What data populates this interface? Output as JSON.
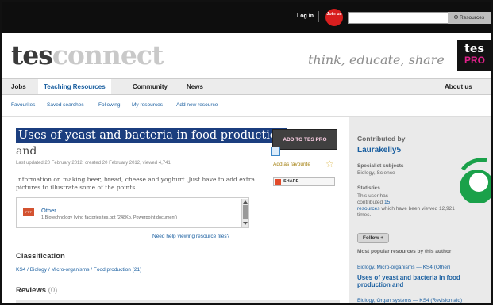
{
  "topbar": {
    "login": "Log in",
    "join": "Join us",
    "search_placeholder": "",
    "search_button": "Resources"
  },
  "brand": {
    "logo_tes": "tes",
    "logo_connect": "connect",
    "tagline": "think, educate, share",
    "badge_top": "tes",
    "badge_pro": "PRO"
  },
  "nav": {
    "items": [
      "Jobs",
      "Teaching Resources",
      "Community",
      "News"
    ],
    "right": "About us"
  },
  "subnav": {
    "links": [
      "Favourites",
      "Saved searches",
      "Following",
      "My resources",
      "Add new resource"
    ]
  },
  "resource": {
    "title_line1": "Uses of yeast and bacteria in food production",
    "title_line2": "and",
    "updated": "Last updated 20 February 2012, created 20 February 2012, viewed 4,741",
    "description": "Information on making beer, bread, cheese and yoghurt. Just have to add extra pictures to illustrate some of the points",
    "add_to_pro": "ADD TO TES PRO",
    "add_favourite": "Add as favourite",
    "share": "SHARE",
    "file": {
      "type_badge": "PPT",
      "category": "Other",
      "filename": "1.Biotechnology living factories tes.ppt (248Kb, Powerpoint document)"
    },
    "help_link": "Need help viewing resource files?",
    "classification_heading": "Classification",
    "classification_path": "KS4 / Biology / Micro-organisms / Food production (21)",
    "reviews_heading": "Reviews",
    "reviews_count": "(0)"
  },
  "sidebar": {
    "contributed_by": "Contributed by",
    "author": "Laurakelly5",
    "specialist_label": "Specialist subjects",
    "specialist_value": "Biology, Science",
    "statistics_label": "Statistics",
    "stats_line1": "This user has",
    "stats_line2_prefix": "contributed",
    "stats_count": "15",
    "stats_line3_link": "resources",
    "stats_line3_rest": "which have been viewed 12,921",
    "stats_line4": "times.",
    "follow": "Follow +",
    "popular_heading": "Most popular resources by this author",
    "popular": [
      {
        "category": "Biology, Micro-organisms — KS4 (Other)",
        "title": "Uses of yeast and bacteria in food production and"
      },
      {
        "category": "Biology, Organ systems — KS4 (Revision aid)",
        "title": ""
      }
    ]
  },
  "colors": {
    "topbar": "#0e0e0e",
    "title_highlight": "#1b3e7f",
    "link": "#1a5fa0",
    "join_red": "#d81e1e",
    "avatar_green": "#1aa14a"
  }
}
